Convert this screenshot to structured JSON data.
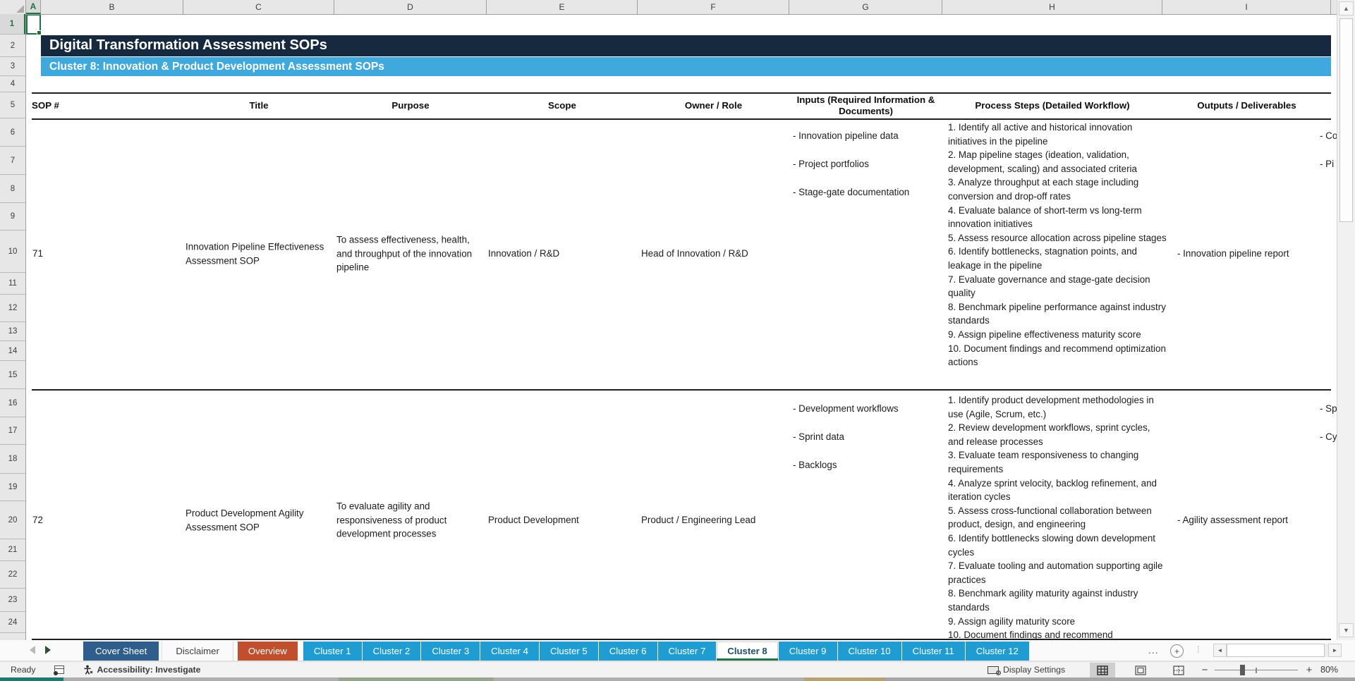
{
  "sheet": {
    "title": "Digital Transformation Assessment SOPs",
    "subtitle": "Cluster 8: Innovation & Product Development Assessment SOPs",
    "grid": {
      "columns": [
        "A",
        "B",
        "C",
        "D",
        "E",
        "F",
        "G",
        "H",
        "I"
      ],
      "rows": [
        1,
        2,
        3,
        4,
        5,
        6,
        7,
        8,
        9,
        10,
        11,
        12,
        13,
        14,
        15,
        16,
        17,
        18,
        19,
        20,
        21,
        22,
        23,
        24
      ]
    },
    "table": {
      "headers": [
        "SOP #",
        "Title",
        "Purpose",
        "Scope",
        "Owner / Role",
        "Inputs (Required Information & Documents)",
        "Process Steps (Detailed Workflow)",
        "Outputs / Deliverables"
      ],
      "rows": [
        {
          "sop": "71",
          "title": "Innovation Pipeline Effectiveness Assessment SOP",
          "purpose": "To assess effectiveness, health, and throughput of the innovation pipeline",
          "scope": "Innovation / R&D",
          "owner": "Head of Innovation / R&D",
          "inputs": [
            "- Innovation pipeline data",
            "- Project portfolios",
            "- Stage-gate documentation"
          ],
          "steps": [
            "1. Identify all active and historical innovation initiatives in the pipeline",
            "2. Map pipeline stages (ideation, validation, development, scaling) and associated criteria",
            "3. Analyze throughput at each stage including conversion and drop-off rates",
            "4. Evaluate balance of short-term vs long-term innovation initiatives",
            "5. Assess resource allocation across pipeline stages",
            "6. Identify bottlenecks, stagnation points, and leakage in the pipeline",
            "7. Evaluate governance and stage-gate decision quality",
            "8. Benchmark pipeline performance against industry standards",
            "9. Assign pipeline effectiveness maturity score",
            "10. Document findings and recommend optimization actions"
          ],
          "outputs": "- Innovation pipeline report",
          "clipped_next_column": [
            "- Co",
            "- Pi"
          ]
        },
        {
          "sop": "72",
          "title": "Product Development Agility Assessment SOP",
          "purpose": "To evaluate agility and responsiveness of product development processes",
          "scope": "Product Development",
          "owner": "Product / Engineering Lead",
          "inputs": [
            "- Development workflows",
            "- Sprint data",
            "- Backlogs"
          ],
          "steps": [
            "1. Identify product development methodologies in use (Agile, Scrum, etc.)",
            "2. Review development workflows, sprint cycles, and release processes",
            "3. Evaluate team responsiveness to changing requirements",
            "4. Analyze sprint velocity, backlog refinement, and iteration cycles",
            "5. Assess cross-functional collaboration between product, design, and engineering",
            "6. Identify bottlenecks slowing down development cycles",
            "7. Evaluate tooling and automation supporting agile practices",
            "8. Benchmark agility maturity against industry standards",
            "9. Assign agility maturity score",
            "10. Document findings and recommend"
          ],
          "outputs": "- Agility assessment report",
          "clipped_next_column": [
            "- Sp",
            "- Cy"
          ]
        }
      ]
    }
  },
  "tabs": {
    "items": [
      {
        "label": "Cover Sheet",
        "style": "cover",
        "active": false
      },
      {
        "label": "Disclaimer",
        "style": "plain",
        "active": false
      },
      {
        "label": "Overview",
        "style": "overview",
        "active": false
      },
      {
        "label": "Cluster 1",
        "style": "cluster",
        "active": false
      },
      {
        "label": "Cluster 2",
        "style": "cluster",
        "active": false
      },
      {
        "label": "Cluster 3",
        "style": "cluster",
        "active": false
      },
      {
        "label": "Cluster 4",
        "style": "cluster",
        "active": false
      },
      {
        "label": "Cluster 5",
        "style": "cluster",
        "active": false
      },
      {
        "label": "Cluster 6",
        "style": "cluster",
        "active": false
      },
      {
        "label": "Cluster 7",
        "style": "cluster",
        "active": false
      },
      {
        "label": "Cluster 8",
        "style": "cluster",
        "active": true
      },
      {
        "label": "Cluster 9",
        "style": "cluster",
        "active": false
      },
      {
        "label": "Cluster 10",
        "style": "cluster",
        "active": false
      },
      {
        "label": "Cluster 11",
        "style": "cluster",
        "active": false
      },
      {
        "label": "Cluster 12",
        "style": "cluster",
        "active": false
      }
    ],
    "overflow_label": "...",
    "new_sheet_label": "+"
  },
  "status": {
    "ready": "Ready",
    "accessibility": "Accessibility: Investigate",
    "display_settings": "Display Settings",
    "zoom_level": "80%"
  },
  "colors": {
    "title_bar": "#16293F",
    "subtitle_bar": "#3FA8DC",
    "tab_cover": "#2F5D8C",
    "tab_overview": "#C0502D",
    "tab_cluster": "#1F9DD3",
    "active_tab_underline": "#217346",
    "selection_green": "#1E7145"
  }
}
